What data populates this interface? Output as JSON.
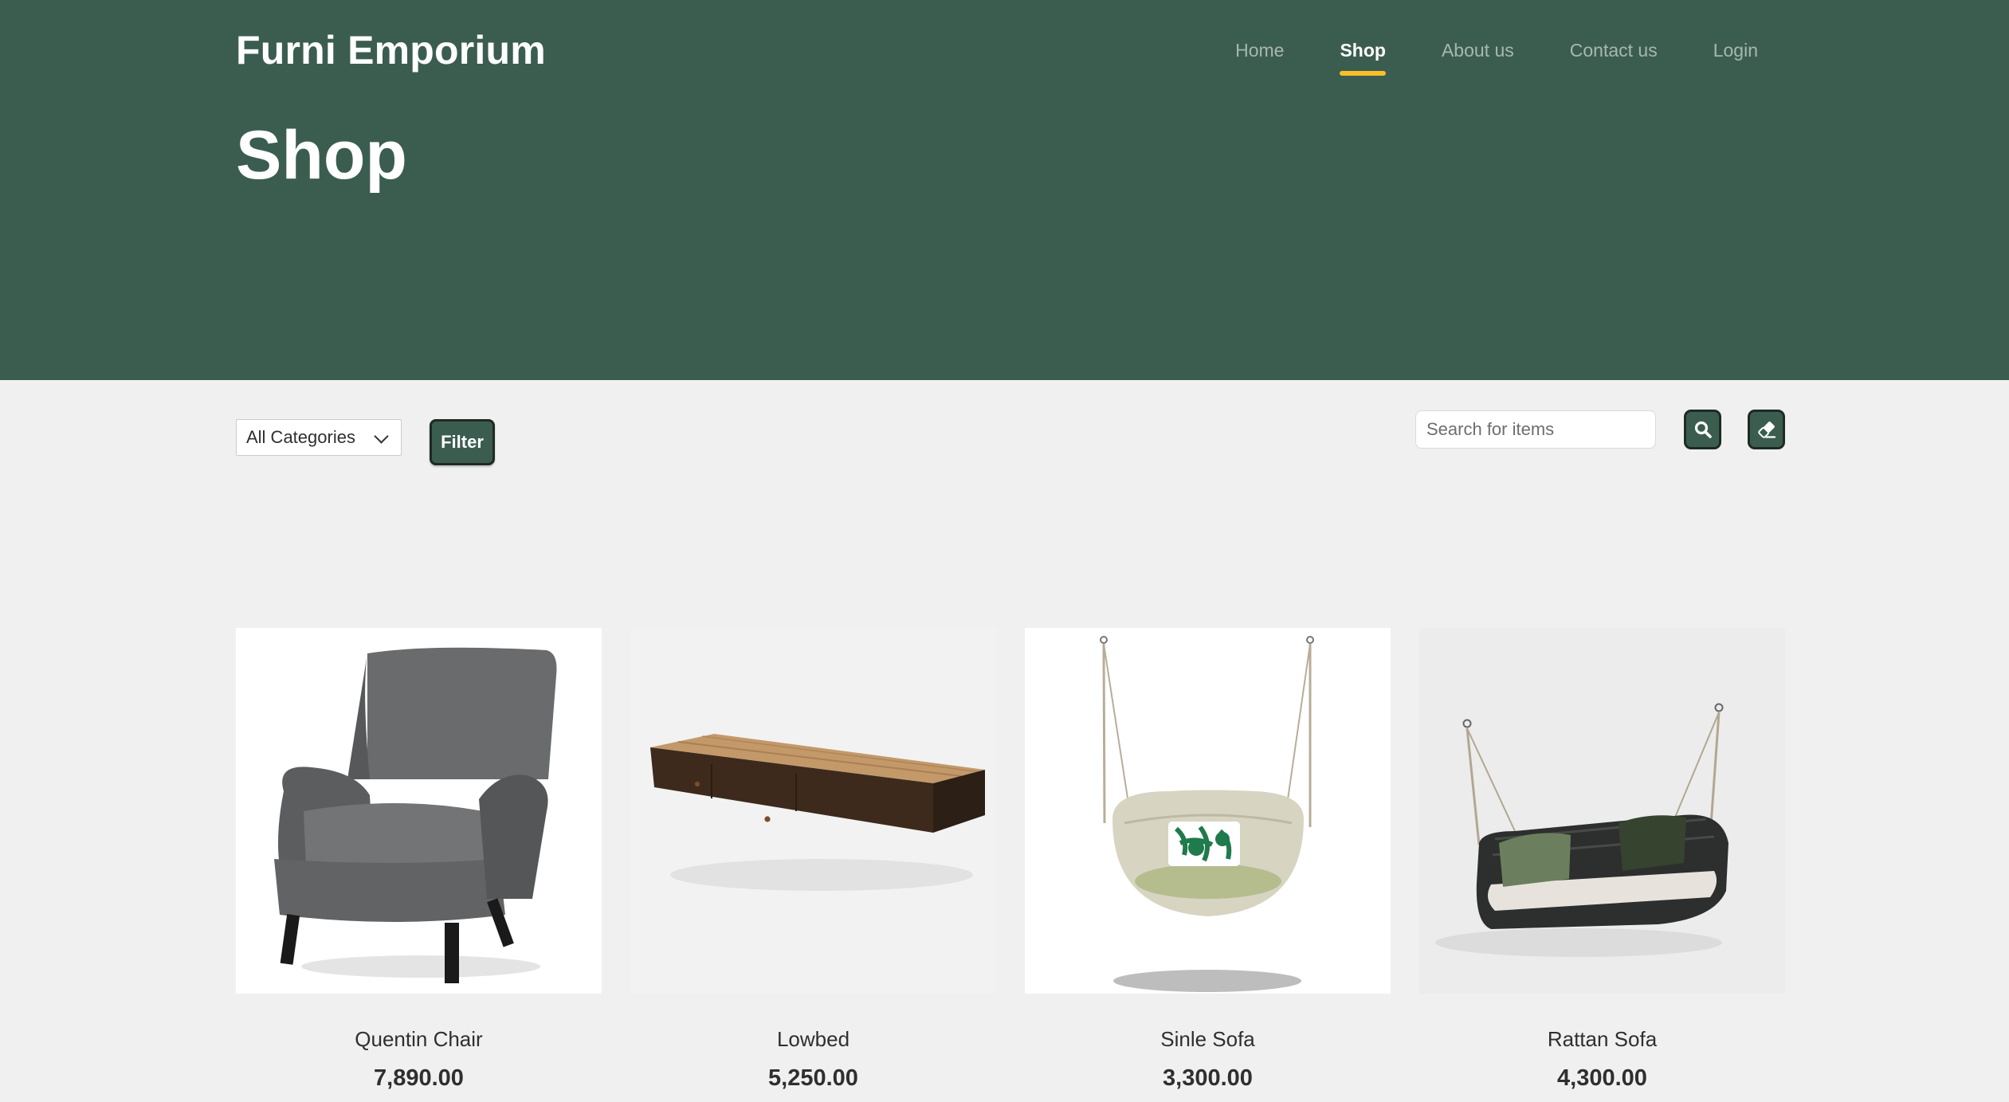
{
  "brand": "Furni Emporium",
  "nav": {
    "items": [
      {
        "label": "Home",
        "active": false
      },
      {
        "label": "Shop",
        "active": true
      },
      {
        "label": "About us",
        "active": false
      },
      {
        "label": "Contact us",
        "active": false
      },
      {
        "label": "Login",
        "active": false
      }
    ]
  },
  "hero": {
    "title": "Shop"
  },
  "toolbar": {
    "category_selected": "All Categories",
    "filter_label": "Filter",
    "search_placeholder": "Search for items",
    "search_icon": "search-icon",
    "clear_icon": "eraser-icon"
  },
  "products": [
    {
      "name": "Quentin Chair",
      "price": "7,890.00"
    },
    {
      "name": "Lowbed",
      "price": "5,250.00"
    },
    {
      "name": "Sinle Sofa",
      "price": "3,300.00"
    },
    {
      "name": "Rattan Sofa",
      "price": "4,300.00"
    }
  ],
  "colors": {
    "primary": "#3b5d50",
    "accent": "#f9bf29",
    "background": "#eff0ef"
  }
}
